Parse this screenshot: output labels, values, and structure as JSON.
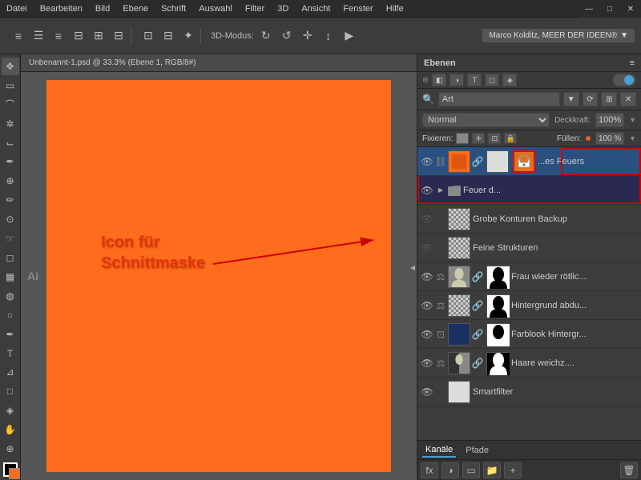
{
  "menubar": {
    "items": [
      "Datei",
      "Bearbeiten",
      "Bild",
      "Ebene",
      "Schrift",
      "Auswahl",
      "Filter",
      "3D",
      "Ansicht",
      "Fenster",
      "Hilfe"
    ]
  },
  "window_controls": {
    "minimize": "—",
    "maximize": "□",
    "close": "✕"
  },
  "toolbar": {
    "label_3d": "3D-Modus:",
    "user_name": "Marco Kolditz, MEER DER IDEEN®"
  },
  "layers_panel": {
    "title": "Ebenen",
    "search_placeholder": "Art",
    "blend_mode": "Normal",
    "opacity_label": "Deckkraft:",
    "opacity_value": "100%",
    "fill_label": "Füllen:",
    "fill_value": "100 %",
    "lock_label": "Fixieren:"
  },
  "layers": [
    {
      "name": "...es Feuers",
      "type": "art",
      "visible": true,
      "has_mask": true,
      "thumb_color": "orange",
      "mask_color": "white",
      "has_clip": true,
      "active": true,
      "highlight": true
    },
    {
      "name": "Feuer d...",
      "type": "group",
      "visible": true,
      "has_mask": false,
      "thumb_color": "folder",
      "active": false,
      "highlight": true
    },
    {
      "name": "Grobe Konturen Backup",
      "type": "normal",
      "visible": false,
      "has_mask": false,
      "thumb_color": "checker",
      "active": false
    },
    {
      "name": "Feine Strukturen",
      "type": "normal",
      "visible": false,
      "has_mask": false,
      "thumb_color": "checker",
      "active": false
    },
    {
      "name": "Frau wieder rötlic...",
      "type": "normal",
      "visible": true,
      "has_mask": true,
      "thumb_color": "photo_woman",
      "mask_color": "white_black",
      "active": false
    },
    {
      "name": "Hintergrund abdu...",
      "type": "normal",
      "visible": true,
      "has_mask": true,
      "thumb_color": "checker",
      "mask_color": "white_black2",
      "active": false
    },
    {
      "name": "Farblook Hintergr...",
      "type": "art",
      "visible": true,
      "has_mask": true,
      "thumb_color": "dark_blue",
      "mask_color": "white_black3",
      "active": false
    },
    {
      "name": "Haare weichz....",
      "type": "normal",
      "visible": true,
      "has_mask": true,
      "thumb_color": "photo_hair",
      "mask_color": "black_white",
      "active": false
    },
    {
      "name": "Smartfilter",
      "type": "normal",
      "visible": true,
      "has_mask": false,
      "thumb_color": "white",
      "active": false
    }
  ],
  "footer": {
    "tabs": [
      "Kanäle",
      "Pfade"
    ]
  },
  "annotation": {
    "line1": "Icon für",
    "line2": "Schnittmaske"
  }
}
